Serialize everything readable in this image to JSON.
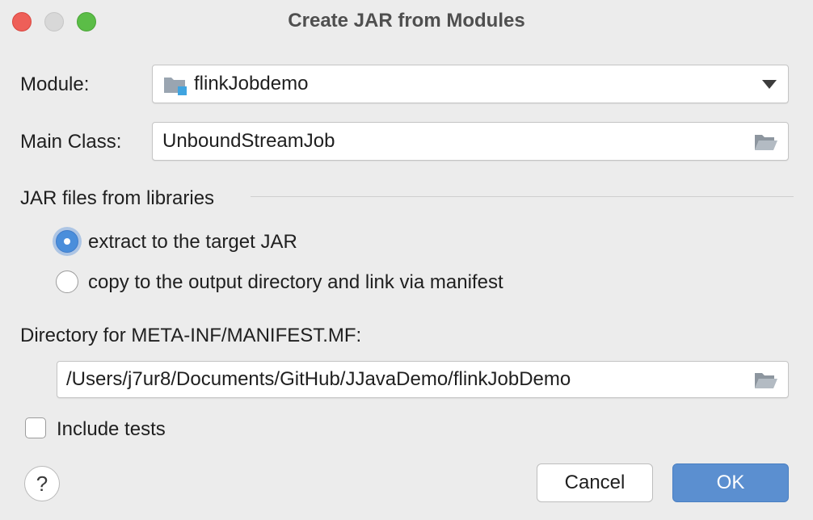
{
  "window": {
    "title": "Create JAR from Modules"
  },
  "module": {
    "label": "Module:",
    "value": "flinkJobdemo"
  },
  "main_class": {
    "label": "Main Class:",
    "value": "UnboundStreamJob"
  },
  "libraries": {
    "heading": "JAR files from libraries",
    "options": [
      {
        "label": "extract to the target JAR",
        "selected": true
      },
      {
        "label": "copy to the output directory and link via manifest",
        "selected": false
      }
    ]
  },
  "manifest": {
    "label": "Directory for META-INF/MANIFEST.MF:",
    "value": "/Users/j7ur8/Documents/GitHub/JJavaDemo/flinkJobDemo"
  },
  "include_tests": {
    "label": "Include tests",
    "checked": false
  },
  "buttons": {
    "help": "?",
    "cancel": "Cancel",
    "ok": "OK"
  },
  "colors": {
    "accent": "#5b8fd0",
    "close": "#ee5f58",
    "maximize": "#5bbd47"
  }
}
